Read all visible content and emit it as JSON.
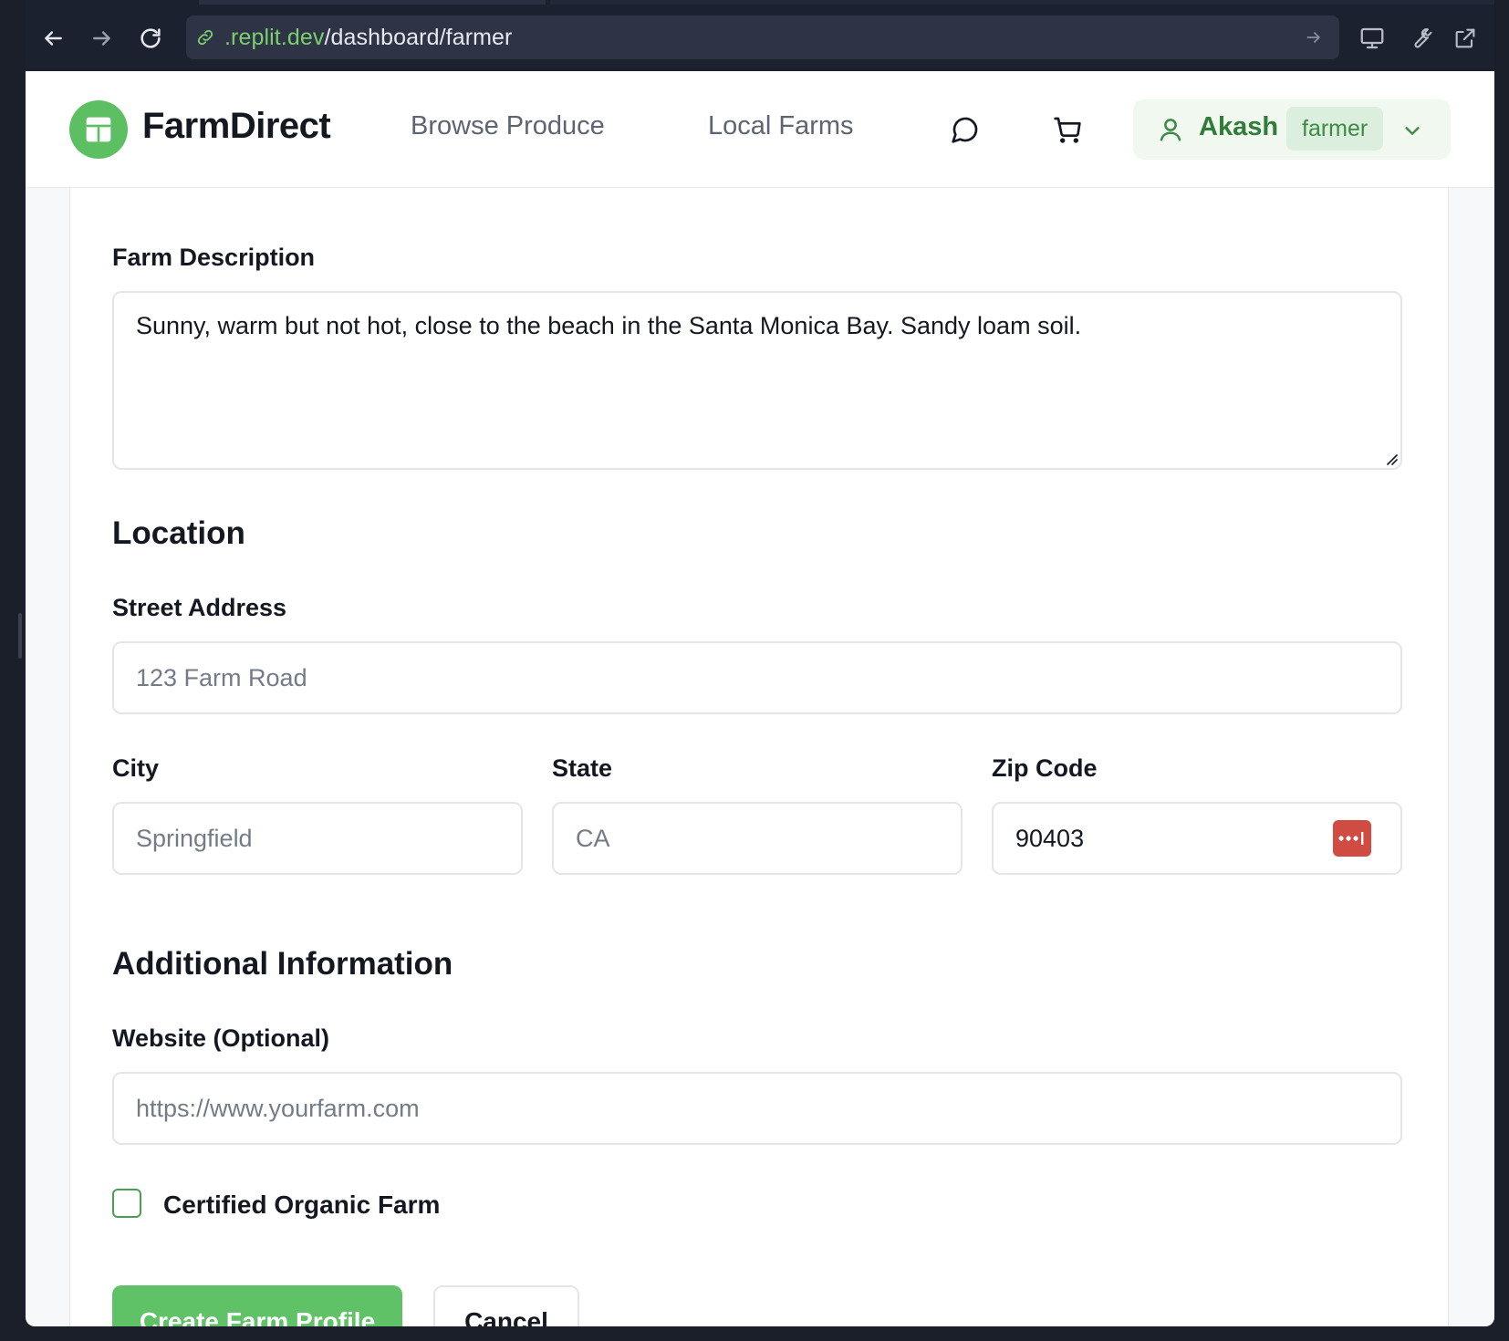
{
  "browser": {
    "url_host": ".replit.dev",
    "url_path": "/dashboard/farmer",
    "back_icon": "arrow-left-icon",
    "forward_icon": "arrow-right-icon",
    "reload_icon": "reload-icon"
  },
  "header": {
    "brand": "FarmDirect",
    "nav": {
      "browse": "Browse Produce",
      "farms": "Local Farms"
    },
    "user": {
      "name": "Akash",
      "role": "farmer"
    },
    "accent": "#5cbf62"
  },
  "form": {
    "description_label": "Farm Description",
    "description_value": "Sunny, warm but not hot, close to the beach in the Santa Monica Bay. Sandy loam soil.",
    "location_title": "Location",
    "street_label": "Street Address",
    "street_placeholder": "123 Farm Road",
    "city_label": "City",
    "city_placeholder": "Springfield",
    "state_label": "State",
    "state_placeholder": "CA",
    "zip_label": "Zip Code",
    "zip_value": "90403",
    "additional_title": "Additional Information",
    "website_label": "Website (Optional)",
    "website_placeholder": "https://www.yourfarm.com",
    "organic_label": "Certified Organic Farm",
    "organic_checked": false,
    "submit_label": "Create Farm Profile",
    "cancel_label": "Cancel"
  }
}
